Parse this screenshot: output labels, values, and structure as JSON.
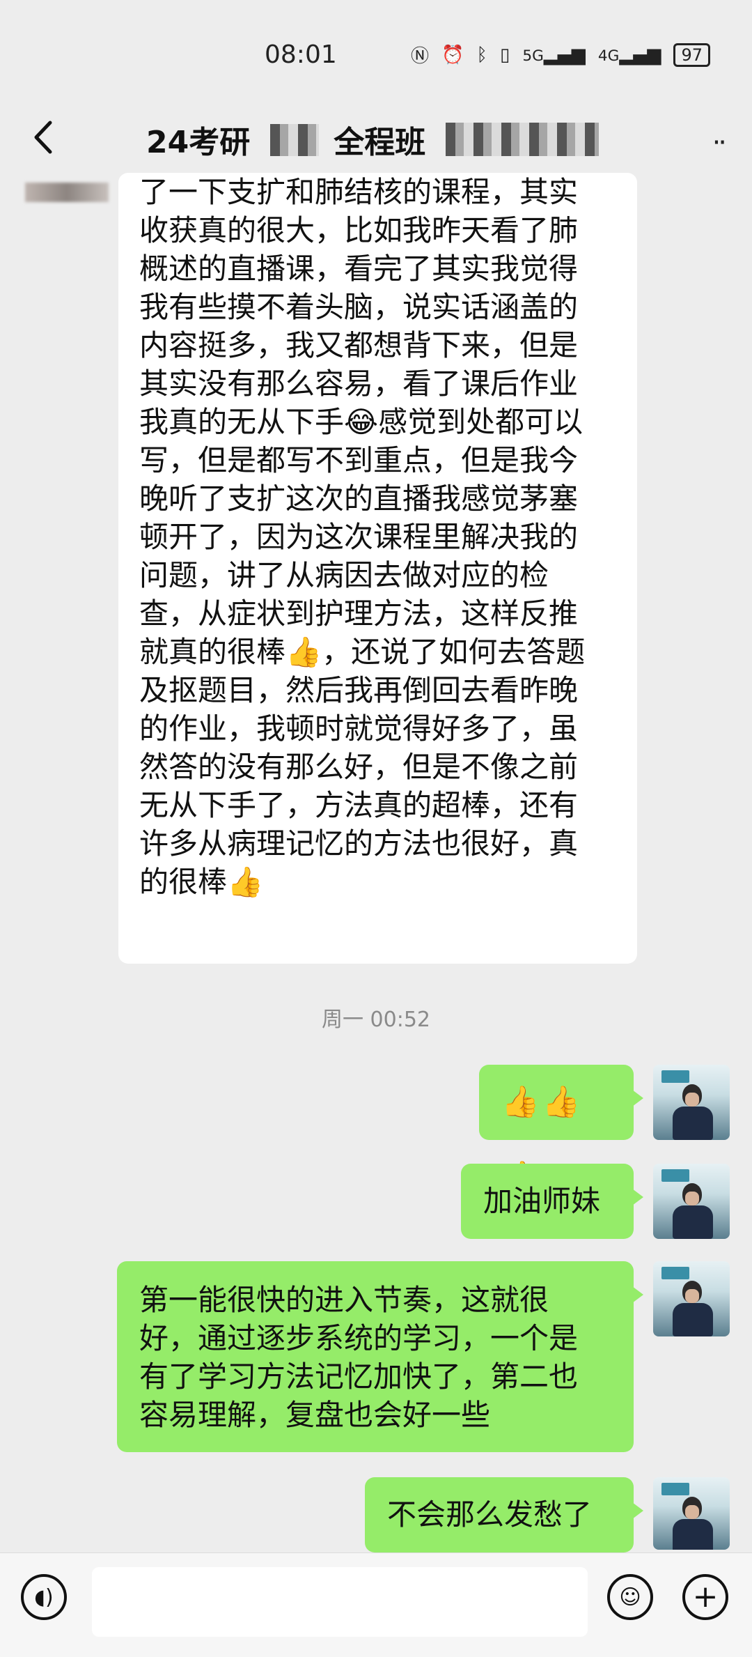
{
  "status_bar": {
    "time": "08:01",
    "battery": "97",
    "icons": [
      "nfc-icon",
      "alarm-icon",
      "bluetooth-icon",
      "vibrate-icon",
      "signal-5g-icon",
      "signal-4g-icon",
      "battery-icon"
    ],
    "network_a": "5G",
    "network_b": "4G"
  },
  "header": {
    "title_part1": "24考研",
    "title_part2": "全程班",
    "back_icon": "chevron-left-icon",
    "more_icon": "more-dots-icon",
    "more_glyph": "··"
  },
  "messages": {
    "received_1": {
      "text": "了一下支扩和肺结核的课程，其实\n收获真的很大，比如我昨天看了肺\n概述的直播课，看完了其实我觉得\n我有些摸不着头脑，说实话涵盖的\n内容挺多，我又都想背下来，但是\n其实没有那么容易，看了课后作业\n我真的无从下手😂感觉到处都可以\n写，但是都写不到重点，但是我今\n晚听了支扩这次的直播我感觉茅塞\n顿开了，因为这次课程里解决我的\n问题，讲了从病因去做对应的检\n查，从症状到护理方法，这样反推\n就真的很棒👍，还说了如何去答题\n及抠题目，然后我再倒回去看昨晚\n的作业，我顿时就觉得好多了，虽\n然答的没有那么好，但是不像之前\n无从下手了，方法真的超棒，还有\n许多从病理记忆的方法也很好，真\n的很棒👍"
    },
    "timestamp": "周一 00:52",
    "sent_1": {
      "text": "👍👍👍"
    },
    "sent_2": {
      "text": "加油师妹"
    },
    "sent_3": {
      "text": "第一能很快的进入节奏，这就很\n好，通过逐步系统的学习，一个是\n有了学习方法记忆加快了，第二也\n容易理解，复盘也会好一些"
    },
    "sent_4": {
      "text": "不会那么发愁了"
    }
  },
  "bottom_bar": {
    "voice_icon": "voice-icon",
    "voice_glyph": "◖)",
    "emoji_icon": "smiley-icon",
    "emoji_glyph": "☺",
    "plus_icon": "plus-icon",
    "plus_glyph": "+",
    "input_value": ""
  },
  "colors": {
    "sent_bubble": "#95ec69",
    "received_bubble": "#ffffff",
    "background": "#ededed"
  }
}
